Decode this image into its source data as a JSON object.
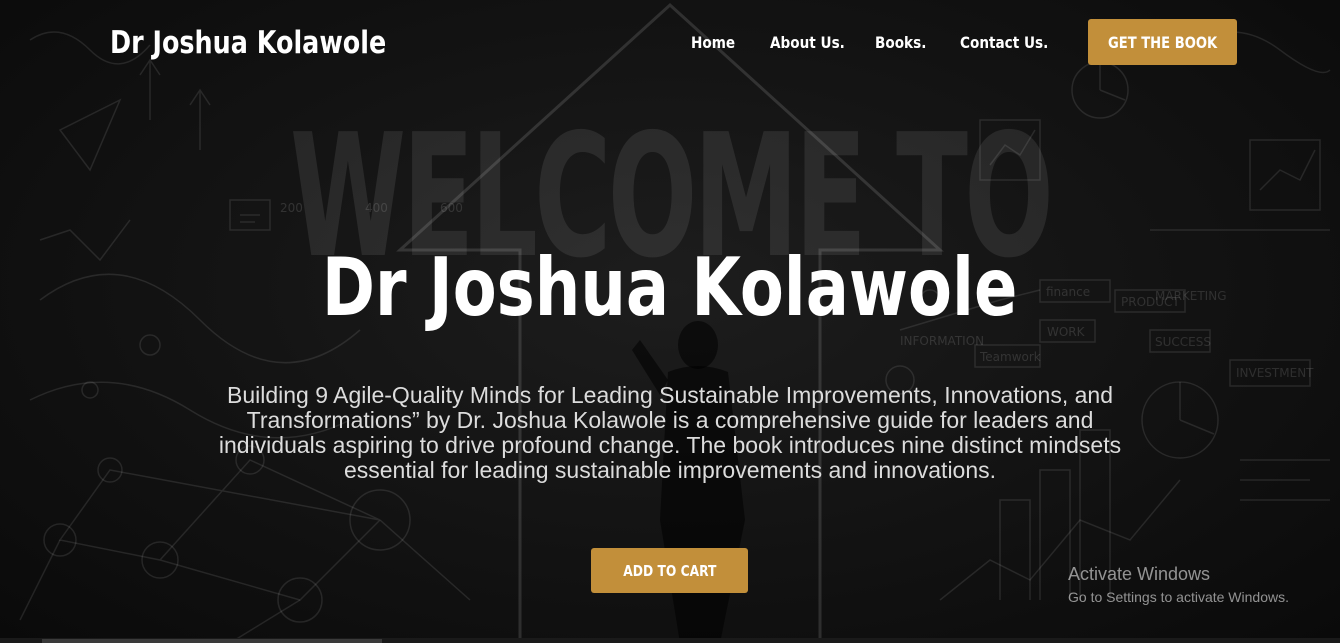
{
  "header": {
    "brand": "Dr Joshua Kolawole",
    "nav": [
      {
        "label": "Home"
      },
      {
        "label": "About Us."
      },
      {
        "label": "Books."
      },
      {
        "label": "Contact Us."
      }
    ],
    "cta_label": "GET THE BOOK"
  },
  "hero": {
    "watermark": "WELCOME TO",
    "title": "Dr Joshua Kolawole",
    "description": "Building 9 Agile-Quality Minds for Leading Sustainable Improvements, Innovations, and Transformations” by Dr. Joshua Kolawole is a comprehensive guide for leaders and individuals aspiring to drive profound change. The book introduces nine distinct mindsets essential for leading sustainable improvements and innovations.",
    "cart_label": "ADD TO CART"
  },
  "background_sketch_labels": {
    "finance": "finance",
    "product": "PRODUCT",
    "marketing": "MARKETING",
    "work": "WORK",
    "success": "SUCCESS",
    "teamwork": "Teamwork",
    "investment": "INVESTMENT",
    "information": "INFORMATION",
    "n200": "200",
    "n400": "400",
    "n600": "600"
  },
  "os_overlay": {
    "activate_title": "Activate Windows",
    "activate_sub": "Go to Settings to activate Windows."
  },
  "colors": {
    "accent": "#c28f3a",
    "background": "#121212",
    "text": "#ffffff"
  },
  "icons": {
    "background": "business-sketch-arrow"
  }
}
